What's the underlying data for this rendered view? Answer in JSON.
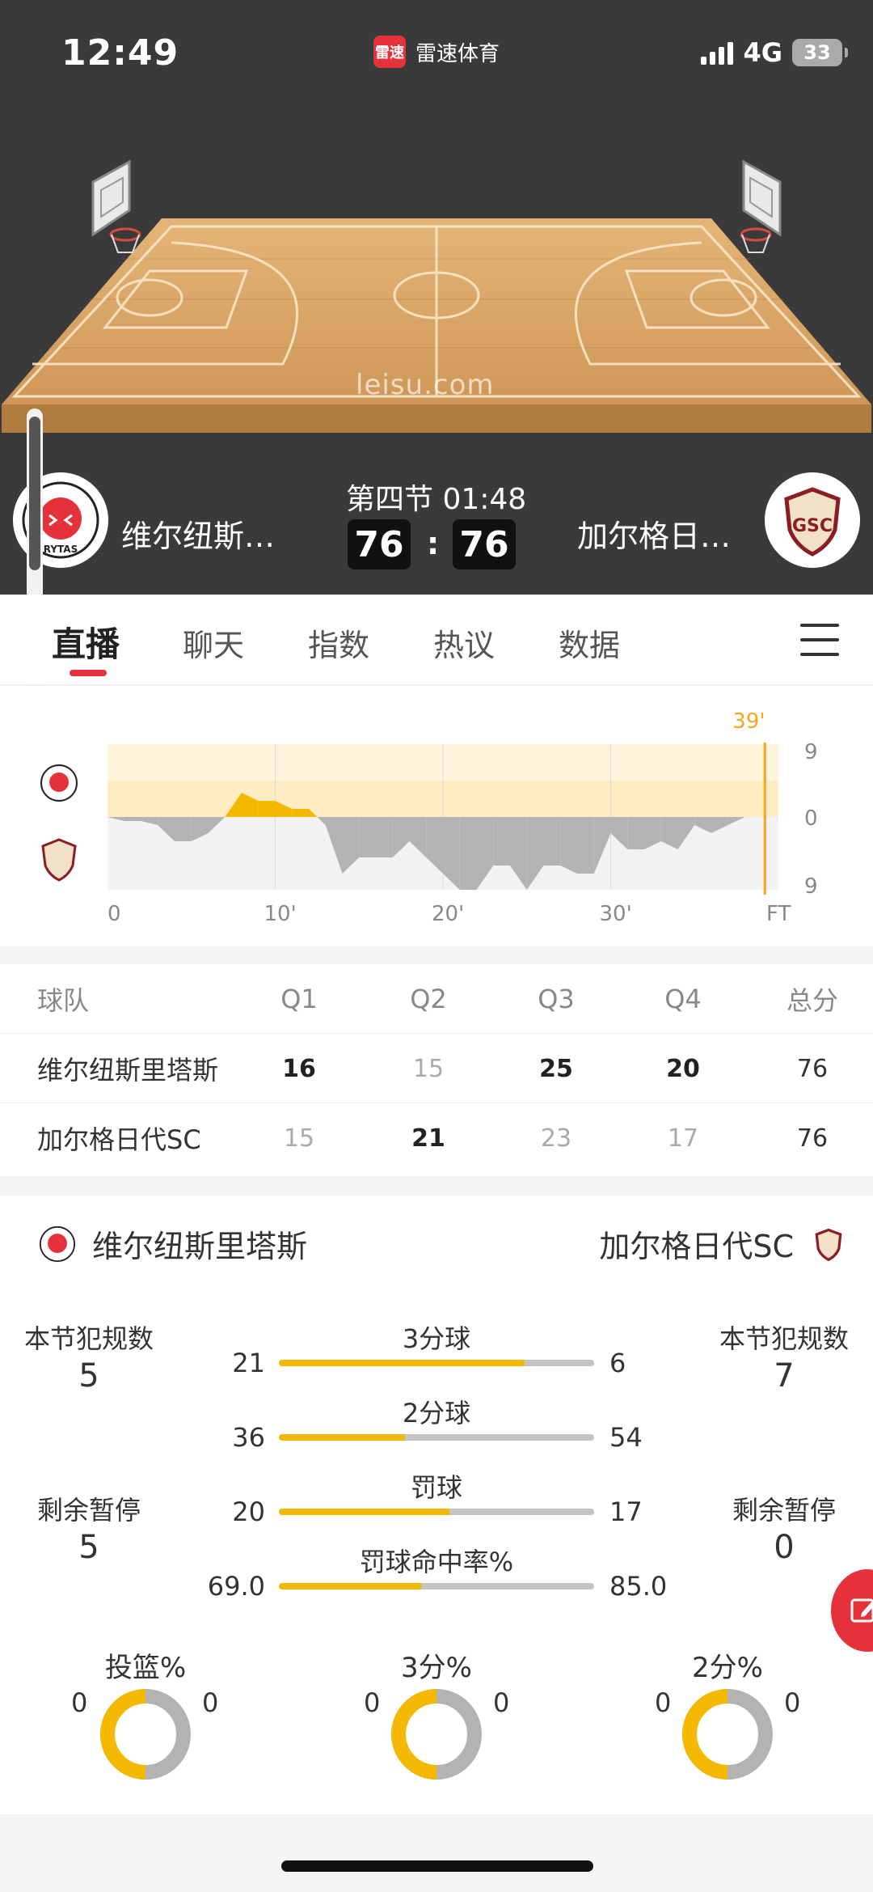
{
  "status_bar": {
    "time": "12:49",
    "app_name": "雷速体育",
    "app_logo_text": "雷速",
    "network": "4G",
    "battery": "33"
  },
  "court": {
    "watermark": "leisu.com",
    "colors": {
      "wood": "#d9a764",
      "line": "#f6e3c0"
    }
  },
  "match": {
    "period": "第四节 01:48",
    "home": {
      "name": "维尔纽斯…",
      "logo_text": "RYTAS",
      "score": "76",
      "color": "#e5323a"
    },
    "away": {
      "name": "加尔格日…",
      "logo_text": "GSC",
      "score": "76",
      "color": "#8b1d24"
    },
    "colon": ":"
  },
  "tabs": [
    {
      "label": "直播",
      "active": true
    },
    {
      "label": "聊天"
    },
    {
      "label": "指数"
    },
    {
      "label": "热议"
    },
    {
      "label": "数据"
    }
  ],
  "momentum": {
    "current_minute_label": "39'",
    "y_labels": [
      "9",
      "0",
      "9"
    ],
    "x_labels": [
      "0",
      "10'",
      "20'",
      "30'",
      "FT"
    ],
    "home_color": "#f5b800",
    "away_color": "#b3b3b3",
    "minutes": [
      0,
      1,
      2,
      3,
      4,
      5,
      6,
      7,
      8,
      9,
      10,
      11,
      12,
      13,
      14,
      15,
      16,
      17,
      18,
      19,
      20,
      21,
      22,
      23,
      24,
      25,
      26,
      27,
      28,
      29,
      30,
      31,
      32,
      33,
      34,
      35,
      36,
      37,
      38,
      39
    ],
    "diff": [
      0,
      -0.5,
      -0.5,
      -1,
      -3,
      -3,
      -2,
      0,
      3,
      2,
      2,
      1,
      1,
      -1,
      -7,
      -5,
      -5,
      -5,
      -3,
      -5,
      -7,
      -9,
      -9,
      -6,
      -6,
      -9,
      -6,
      -6,
      -7,
      -7,
      -2,
      -4,
      -4,
      -3,
      -4,
      -1,
      -2,
      -1,
      0,
      0
    ]
  },
  "quarter_table": {
    "headers": [
      "球队",
      "Q1",
      "Q2",
      "Q3",
      "Q4",
      "总分"
    ],
    "rows": [
      {
        "team": "维尔纽斯里塔斯",
        "scores": [
          "16",
          "15",
          "25",
          "20"
        ],
        "total": "76",
        "win": [
          true,
          false,
          true,
          true
        ]
      },
      {
        "team": "加尔格日代SC",
        "scores": [
          "15",
          "21",
          "23",
          "17"
        ],
        "total": "76",
        "win": [
          false,
          true,
          false,
          false
        ]
      }
    ]
  },
  "stats": {
    "home_team": "维尔纽斯里塔斯",
    "away_team": "加尔格日代SC",
    "home_fouls_label": "本节犯规数",
    "home_fouls": "5",
    "away_fouls_label": "本节犯规数",
    "away_fouls": "7",
    "home_timeouts_label": "剩余暂停",
    "home_timeouts": "5",
    "away_timeouts_label": "剩余暂停",
    "away_timeouts": "0",
    "bars": [
      {
        "label": "3分球",
        "home": "21",
        "away": "6",
        "home_fraction": 0.78
      },
      {
        "label": "2分球",
        "home": "36",
        "away": "54",
        "home_fraction": 0.4
      },
      {
        "label": "罚球",
        "home": "20",
        "away": "17",
        "home_fraction": 0.54
      },
      {
        "label": "罚球命中率%",
        "home": "69.0",
        "away": "85.0",
        "home_fraction": 0.45
      }
    ],
    "rings": [
      {
        "label": "投篮%",
        "home": "0",
        "away": "0"
      },
      {
        "label": "3分%",
        "home": "0",
        "away": "0"
      },
      {
        "label": "2分%",
        "home": "0",
        "away": "0"
      }
    ]
  }
}
